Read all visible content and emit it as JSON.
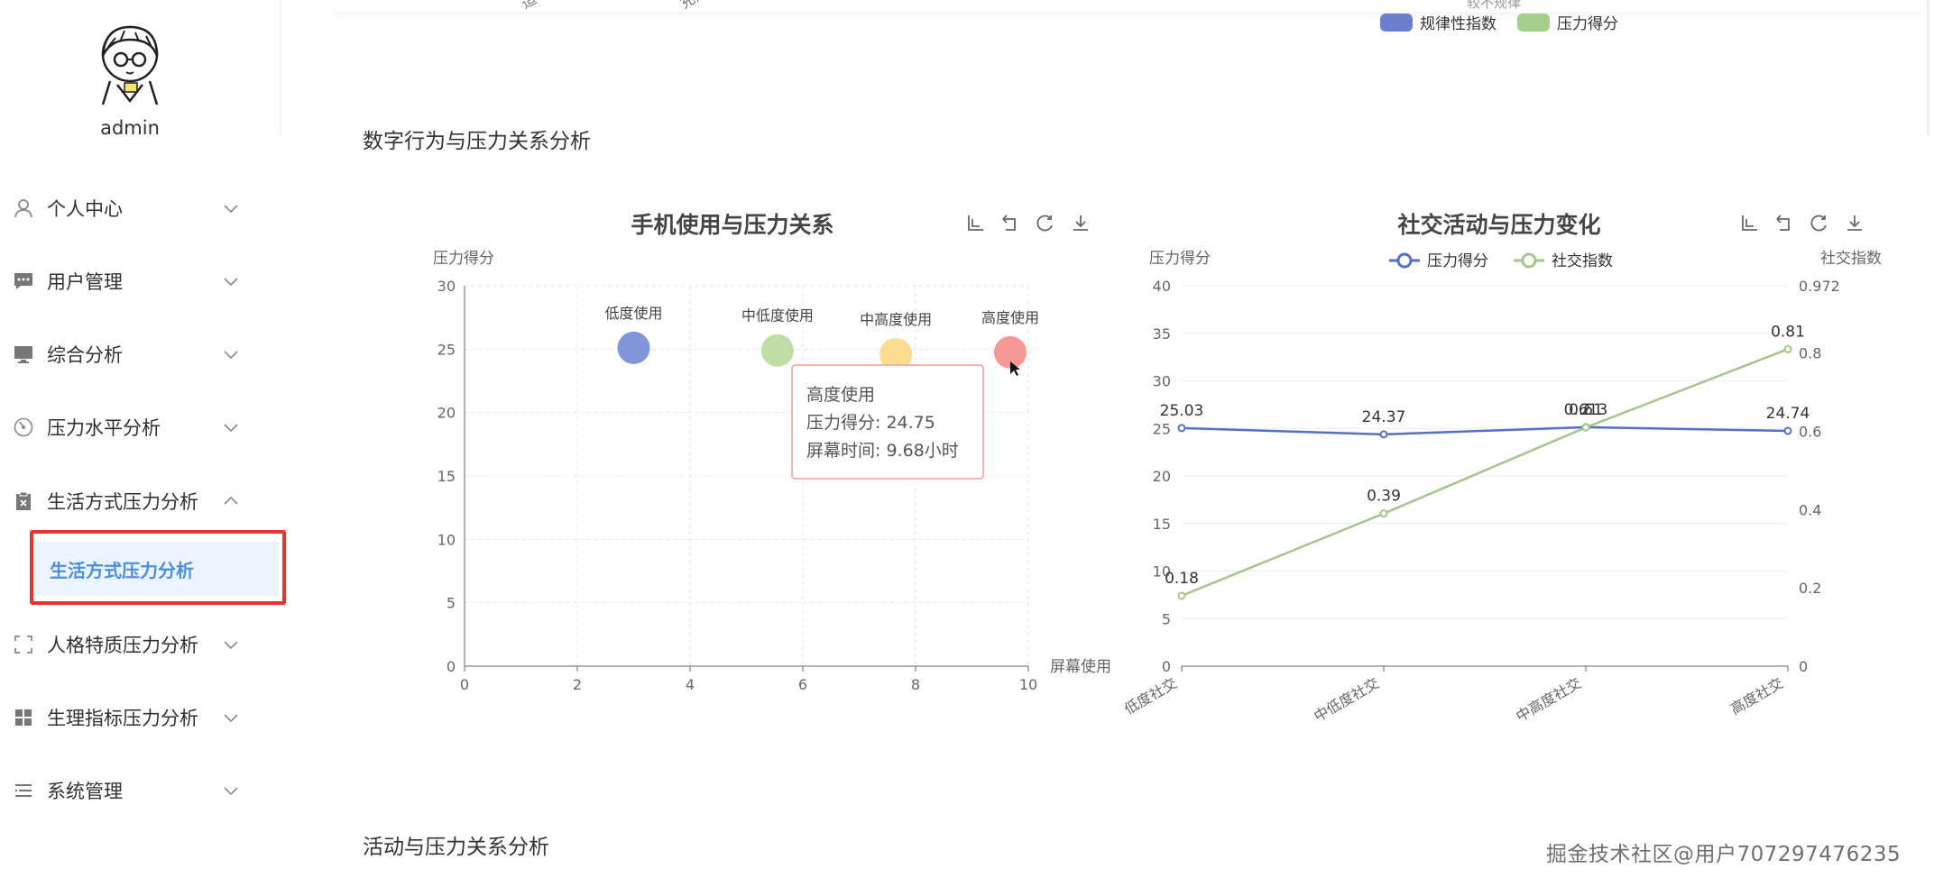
{
  "sidebar": {
    "username": "admin",
    "items": [
      {
        "label": "个人中心",
        "icon": "user-icon"
      },
      {
        "label": "用户管理",
        "icon": "chat-icon"
      },
      {
        "label": "综合分析",
        "icon": "monitor-icon"
      },
      {
        "label": "压力水平分析",
        "icon": "gauge-icon"
      },
      {
        "label": "生活方式压力分析",
        "icon": "clipboard-icon"
      },
      {
        "label": "人格特质压力分析",
        "icon": "fullscreen-icon"
      },
      {
        "label": "生理指标压力分析",
        "icon": "grid-icon"
      },
      {
        "label": "系统管理",
        "icon": "list-icon"
      }
    ],
    "active_submenu": "生活方式压力分析"
  },
  "top_chart": {
    "clipped_labels": [
      "适中",
      "充足",
      "较不规律"
    ],
    "legend": [
      {
        "label": "规律性指数",
        "color": "#6b7fcc"
      },
      {
        "label": "压力得分",
        "color": "#a4cf8a"
      }
    ]
  },
  "sections": {
    "digital": "数字行为与压力关系分析",
    "activity": "活动与压力关系分析"
  },
  "watermark": "掘金技术社区@用户707297476235",
  "chart_data": [
    {
      "type": "scatter",
      "title": "手机使用与压力关系",
      "xlabel": "屏幕使用",
      "ylabel": "压力得分",
      "xlim": [
        0,
        10
      ],
      "ylim": [
        0,
        30
      ],
      "xticks": [
        0,
        2,
        4,
        6,
        8,
        10
      ],
      "yticks": [
        0,
        5,
        10,
        15,
        20,
        25,
        30
      ],
      "points": [
        {
          "label": "低度使用",
          "x": 3.0,
          "y": 25.1,
          "color": "#7b8fd6"
        },
        {
          "label": "中低度使用",
          "x": 5.55,
          "y": 24.9,
          "color": "#bcdba0"
        },
        {
          "label": "中高度使用",
          "x": 7.65,
          "y": 24.6,
          "color": "#fdd98a"
        },
        {
          "label": "高度使用",
          "x": 9.68,
          "y": 24.75,
          "color": "#f7928f"
        }
      ],
      "tooltip": {
        "title": "高度使用",
        "line1": "压力得分: 24.75",
        "line2": "屏幕时间: 9.68小时"
      },
      "toolbox": [
        "zoom-icon",
        "zoom-reset-icon",
        "refresh-icon",
        "download-icon"
      ]
    },
    {
      "type": "line",
      "title": "社交活动与压力变化",
      "categories": [
        "低度社交",
        "中低度社交",
        "中高度社交",
        "高度社交"
      ],
      "ylabel": "压力得分",
      "y2label": "社交指数",
      "ylim": [
        0,
        40
      ],
      "y2lim": [
        0,
        0.972
      ],
      "yticks": [
        0,
        5,
        10,
        15,
        20,
        25,
        30,
        35,
        40
      ],
      "y2ticks": [
        "0",
        "0.2",
        "0.4",
        "0.6",
        "0.8",
        "0.972"
      ],
      "series": [
        {
          "name": "压力得分",
          "axis": "left",
          "color": "#5470c6",
          "values": [
            25.03,
            24.37,
            25.13,
            24.74
          ],
          "labels": [
            "25.03",
            "24.37",
            "2",
            "24.74"
          ]
        },
        {
          "name": "社交指数",
          "axis": "right",
          "color": "#a4c68a",
          "values": [
            0.18,
            0.39,
            0.61,
            0.81
          ],
          "labels": [
            "0.18",
            "0.39",
            "0.61",
            "0.81"
          ]
        }
      ],
      "overlap_label": "0.613",
      "toolbox": [
        "zoom-icon",
        "zoom-reset-icon",
        "refresh-icon",
        "download-icon"
      ]
    }
  ]
}
